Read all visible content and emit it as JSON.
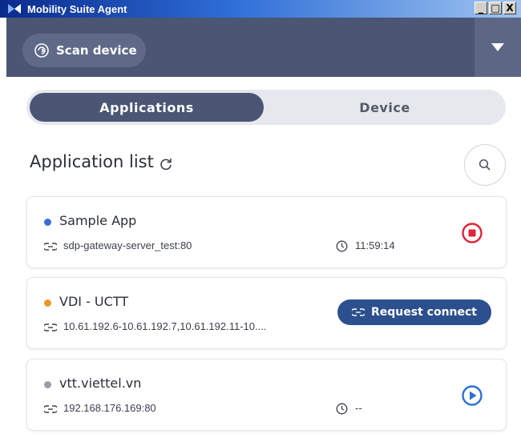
{
  "window": {
    "title": "Mobility Suite Agent",
    "minimize": "_",
    "maximize": "□",
    "close": "X"
  },
  "header": {
    "scan_label": "Scan device"
  },
  "tabs": [
    {
      "label": "Applications",
      "active": true
    },
    {
      "label": "Device",
      "active": false
    }
  ],
  "section": {
    "title": "Application list"
  },
  "apps": [
    {
      "name": "Sample App",
      "status_color": "#3b6fd4",
      "address": "sdp-gateway-server_test:80",
      "time": "11:59:14",
      "action": "stop"
    },
    {
      "name": "VDI - UCTT",
      "status_color": "#e8962a",
      "address": "10.61.192.6-10.61.192.7,10.61.192.11-10....",
      "action_label": "Request connect",
      "action": "request-connect"
    },
    {
      "name": "vtt.viettel.vn",
      "status_color": "#9a9ea8",
      "address": "192.168.176.169:80",
      "time": "--",
      "action": "play"
    }
  ],
  "colors": {
    "header": "#4a5674",
    "accent_blue": "#2c4f8e",
    "stop_red": "#e0243a",
    "play_blue": "#2f6fd8"
  }
}
